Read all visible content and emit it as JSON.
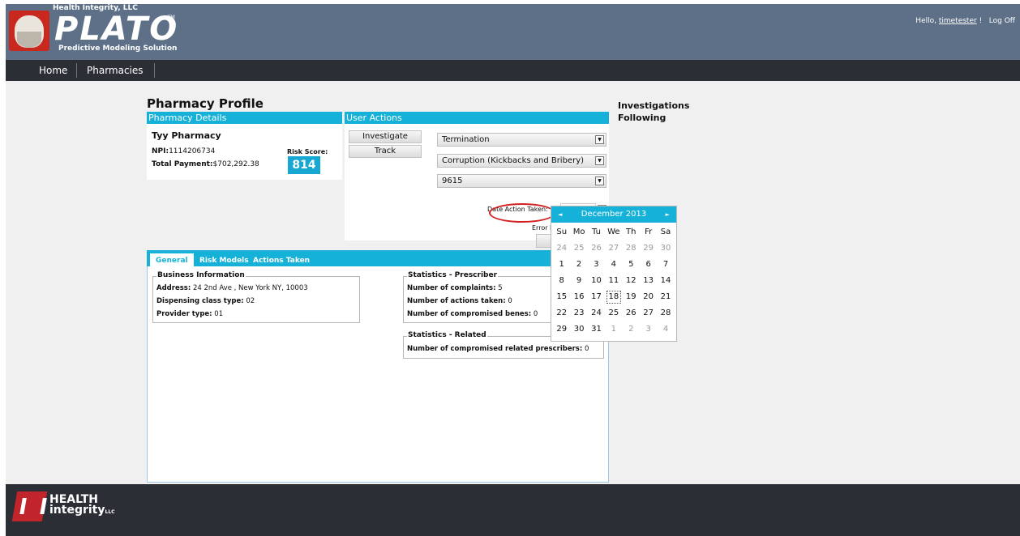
{
  "header": {
    "company": "Health Integrity, LLC",
    "brand": "PLATO",
    "tm": "TM",
    "tagline": "Predictive Modeling Solution",
    "greeting_prefix": "Hello, ",
    "user": "timetester",
    "greeting_suffix": " !",
    "logoff": "Log Off"
  },
  "nav": {
    "items": [
      {
        "label": "Home"
      },
      {
        "label": "Pharmacies"
      }
    ]
  },
  "page": {
    "title": "Pharmacy Profile",
    "side_links": [
      "Investigations",
      "Following"
    ]
  },
  "pharmacy_details": {
    "header": "Pharmacy Details",
    "name": "Tyy Pharmacy",
    "npi_label": "NPI:",
    "npi": "1114206734",
    "total_payment_label": "Total Payment:",
    "total_payment": "$702,292.38",
    "risk_score_label": "Risk Score:",
    "risk_score": "814"
  },
  "user_actions": {
    "header": "User Actions",
    "buttons": [
      "Investigate",
      "Track"
    ],
    "selects": [
      "Termination",
      "Corruption (Kickbacks and Bribery)",
      "9615"
    ],
    "date_label": "Date Action Taken:",
    "error_label": "Error F"
  },
  "tabs": [
    {
      "label": "General"
    },
    {
      "label": "Risk Models"
    },
    {
      "label": "Actions Taken"
    }
  ],
  "general": {
    "business": {
      "legend": "Business Information",
      "address_label": "Address:",
      "address": "24 2nd Ave , New York NY, 10003",
      "dispensing_label": "Dispensing class type:",
      "dispensing": "02",
      "provider_label": "Provider type:",
      "provider": "01"
    },
    "stats_prescriber": {
      "legend": "Statistics - Prescriber",
      "complaints_label": "Number of complaints:",
      "complaints": "5",
      "actions_label": "Number of actions taken:",
      "actions": "0",
      "benes_label": "Number of compromised benes:",
      "benes": "0"
    },
    "stats_related": {
      "legend": "Statistics - Related",
      "related_label": "Number of compromised related prescribers:",
      "related": "0"
    }
  },
  "calendar": {
    "prev": "◄",
    "next": "►",
    "month": "December 2013",
    "weekdays": [
      "Su",
      "Mo",
      "Tu",
      "We",
      "Th",
      "Fr",
      "Sa"
    ],
    "weeks": [
      [
        "24",
        "25",
        "26",
        "27",
        "28",
        "29",
        "30"
      ],
      [
        "1",
        "2",
        "3",
        "4",
        "5",
        "6",
        "7"
      ],
      [
        "8",
        "9",
        "10",
        "11",
        "12",
        "13",
        "14"
      ],
      [
        "15",
        "16",
        "17",
        "18",
        "19",
        "20",
        "21"
      ],
      [
        "22",
        "23",
        "24",
        "25",
        "26",
        "27",
        "28"
      ],
      [
        "29",
        "30",
        "31",
        "1",
        "2",
        "3",
        "4"
      ]
    ],
    "today": "18"
  },
  "footer": {
    "line1": "HEALTH",
    "line2": "integrity",
    "line2_suffix": "LLC"
  }
}
